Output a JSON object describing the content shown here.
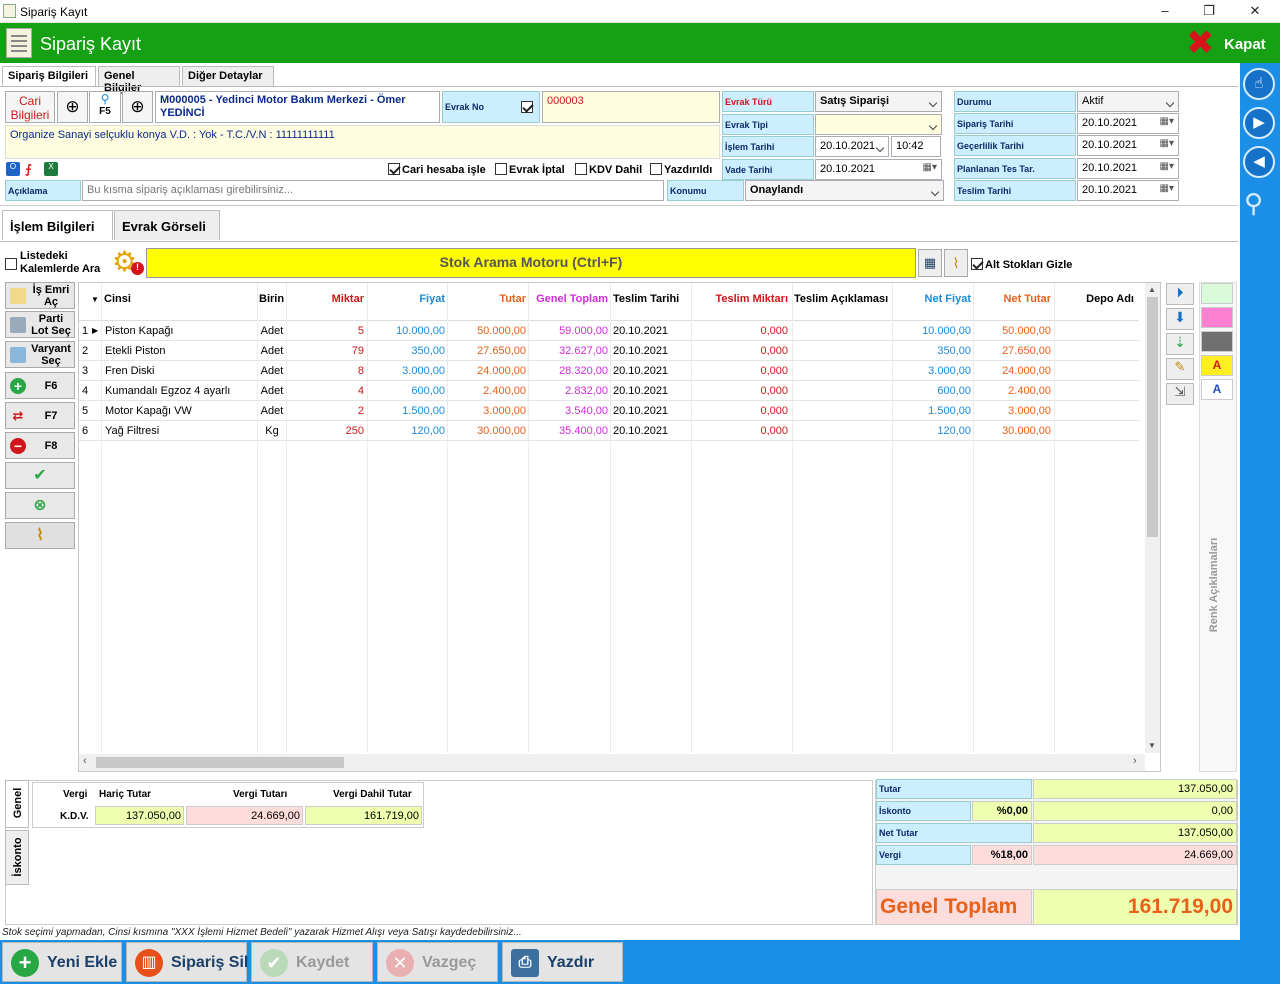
{
  "window": {
    "title": "Sipariş Kayıt",
    "minimize": "–",
    "maximize": "❐",
    "close": "✕"
  },
  "header": {
    "title": "Sipariş Kayıt",
    "close_label": "Kapat"
  },
  "top_tabs": [
    "Sipariş Bilgileri",
    "Genel Bilgiler",
    "Diğer Detaylar"
  ],
  "cari": {
    "label": "Cari Bilgileri",
    "f5": "F5",
    "code_name": "M000005 - Yedinci Motor Bakım Merkezi - Ömer YEDİNCİ",
    "address": "Organize Sanayi selçuklu konya V.D. :  Yok - T.C./V.N :  11111111111",
    "evrak_no_label": "Evrak No",
    "evrak_no": "000003"
  },
  "options": {
    "cari_hesaba": "Cari hesaba işle",
    "evrak_iptal": "Evrak İptal",
    "kdv_dahil": "KDV Dahil",
    "yazdirildi": "Yazdırıldı"
  },
  "aciklama": {
    "label": "Açıklama",
    "placeholder": "Bu kısma sipariş açıklaması girebilirsiniz..."
  },
  "evrak": {
    "turu_label": "Evrak Türü",
    "turu": "Satış Siparişi",
    "tipi_label": "Evrak Tipi",
    "tipi": "",
    "islem_tarihi_label": "İşlem Tarihi",
    "islem_tarihi": "20.10.2021",
    "islem_saati": "10:42",
    "vade_label": "Vade Tarihi",
    "vade": "20.10.2021",
    "konumu_label": "Konumu",
    "konumu": "Onaylandı"
  },
  "durum": {
    "durumu_label": "Durumu",
    "durumu": "Aktif",
    "siparis_tarihi_label": "Sipariş Tarihi",
    "siparis_tarihi": "20.10.2021",
    "gecerlilik_label": "Geçerlilik Tarihi",
    "gecerlilik": "20.10.2021",
    "planlanan_label": "Planlanan Tes Tar.",
    "planlanan": "20.10.2021",
    "teslim_label": "Teslim Tarihi",
    "teslim": "20.10.2021"
  },
  "sub_tabs": [
    "İşlem Bilgileri",
    "Evrak Görseli"
  ],
  "search": {
    "listede_label": "Listedeki Kalemlerde Ara",
    "button": "Stok Arama Motoru (Ctrl+F)",
    "alt_stok": "Alt Stokları Gizle"
  },
  "side_buttons": {
    "is_emri": "İş Emri Aç",
    "parti_lot": "Parti Lot Seç",
    "varyant": "Varyant Seç",
    "f6": "F6",
    "f7": "F7",
    "f8": "F8"
  },
  "columns": [
    "Cinsi",
    "Birin",
    "Miktar",
    "Fiyat",
    "Tutar",
    "Genel Toplam",
    "Teslim Tarihi",
    "Teslim Miktarı",
    "Teslim Açıklaması",
    "Net Fiyat",
    "Net Tutar",
    "Depo Adı"
  ],
  "rows": [
    {
      "no": "1",
      "cinsi": "Piston Kapağı",
      "birim": "Adet",
      "miktar": "5",
      "fiyat": "10.000,00",
      "tutar": "50.000,00",
      "genel": "59.000,00",
      "teslim_tarihi": "20.10.2021",
      "teslim_miktari": "0,000",
      "teslim_aciklama": "",
      "net_fiyat": "10.000,00",
      "net_tutar": "50.000,00",
      "depo": ""
    },
    {
      "no": "2",
      "cinsi": "Etekli Piston",
      "birim": "Adet",
      "miktar": "79",
      "fiyat": "350,00",
      "tutar": "27.650,00",
      "genel": "32.627,00",
      "teslim_tarihi": "20.10.2021",
      "teslim_miktari": "0,000",
      "teslim_aciklama": "",
      "net_fiyat": "350,00",
      "net_tutar": "27.650,00",
      "depo": ""
    },
    {
      "no": "3",
      "cinsi": "Fren Diski",
      "birim": "Adet",
      "miktar": "8",
      "fiyat": "3.000,00",
      "tutar": "24.000,00",
      "genel": "28.320,00",
      "teslim_tarihi": "20.10.2021",
      "teslim_miktari": "0,000",
      "teslim_aciklama": "",
      "net_fiyat": "3.000,00",
      "net_tutar": "24.000,00",
      "depo": ""
    },
    {
      "no": "4",
      "cinsi": "Kumandalı Egzoz 4 ayarlı",
      "birim": "Adet",
      "miktar": "4",
      "fiyat": "600,00",
      "tutar": "2.400,00",
      "genel": "2.832,00",
      "teslim_tarihi": "20.10.2021",
      "teslim_miktari": "0,000",
      "teslim_aciklama": "",
      "net_fiyat": "600,00",
      "net_tutar": "2.400,00",
      "depo": ""
    },
    {
      "no": "5",
      "cinsi": "Motor Kapağı VW",
      "birim": "Adet",
      "miktar": "2",
      "fiyat": "1.500,00",
      "tutar": "3.000,00",
      "genel": "3.540,00",
      "teslim_tarihi": "20.10.2021",
      "teslim_miktari": "0,000",
      "teslim_aciklama": "",
      "net_fiyat": "1.500,00",
      "net_tutar": "3.000,00",
      "depo": ""
    },
    {
      "no": "6",
      "cinsi": "Yağ Filtresi",
      "birim": "Kg",
      "miktar": "250",
      "fiyat": "120,00",
      "tutar": "30.000,00",
      "genel": "35.400,00",
      "teslim_tarihi": "20.10.2021",
      "teslim_miktari": "0,000",
      "teslim_aciklama": "",
      "net_fiyat": "120,00",
      "net_tutar": "30.000,00",
      "depo": ""
    }
  ],
  "color_legend": {
    "label": "Renk Açıklamaları",
    "a1": "A",
    "a2": "A"
  },
  "tax": {
    "tabs": [
      "Genel",
      "İskonto"
    ],
    "headers": [
      "Vergi",
      "Hariç Tutar",
      "Vergi Tutarı",
      "Vergi Dahil Tutar"
    ],
    "row": {
      "vergi": "K.D.V.",
      "haric": "137.050,00",
      "vergi_tutari": "24.669,00",
      "dahil": "161.719,00"
    }
  },
  "totals": {
    "tutar_label": "Tutar",
    "tutar": "137.050,00",
    "iskonto_label": "İskonto",
    "iskonto_pct": "%0,00",
    "iskonto": "0,00",
    "net_label": "Net Tutar",
    "net": "137.050,00",
    "vergi_label": "Vergi",
    "vergi_pct": "%18,00",
    "vergi": "24.669,00",
    "genel_label": "Genel Toplam",
    "genel": "161.719,00"
  },
  "hint": "Stok seçimi yapmadan, Cinsi kısmına \"XXX İşlemi Hizmet Bedeli\" yazarak Hizmet Alışı veya Satışı kaydedebilirsiniz...",
  "bottom_buttons": {
    "yeni": "Yeni Ekle",
    "sil": "Sipariş Sil",
    "kaydet": "Kaydet",
    "vazgec": "Vazgeç",
    "yazdir": "Yazdır"
  },
  "colors": {
    "green": "#16a014",
    "blue": "#1b8fe6",
    "red": "#d0161a",
    "orange": "#e8601a",
    "fiyat_blue": "#1e8ad6",
    "magenta": "#d42adb"
  }
}
